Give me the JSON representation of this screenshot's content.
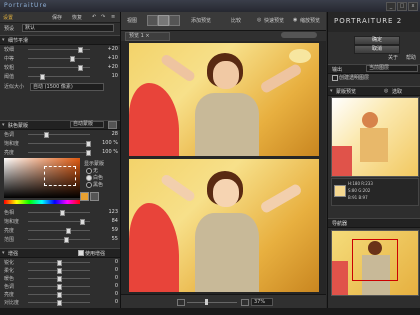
{
  "app": {
    "title": "PortraitUre"
  },
  "left": {
    "tabs": [
      "设置",
      "保存",
      "恢复"
    ],
    "preset_label": "预设",
    "preset_value": "默认",
    "sections": {
      "smooth": "细节平滑",
      "skin": "肤色蒙版",
      "enhance": "增强"
    },
    "smooth_rows": [
      {
        "label": "较细",
        "value": "+20"
      },
      {
        "label": "中等",
        "value": "+10"
      },
      {
        "label": "较粗",
        "value": "+20"
      },
      {
        "label": "阈值",
        "value": "10"
      }
    ],
    "size_label": "近似大小",
    "size_value": "自动 (1500 像素)",
    "skin_mode": "自动蒙版",
    "skin_rows": [
      {
        "label": "色调",
        "value": "28"
      },
      {
        "label": "饱和度",
        "value": "100 %"
      },
      {
        "label": "亮度",
        "value": "100 %"
      }
    ],
    "show_mask": "显示蒙版",
    "mask_opts": [
      "无",
      "白色",
      "黑色"
    ],
    "hsl_rows": [
      {
        "label": "色相",
        "value": "123"
      },
      {
        "label": "饱和度",
        "value": "84"
      },
      {
        "label": "亮度",
        "value": "59"
      },
      {
        "label": "范围",
        "value": "55"
      }
    ],
    "enhance_toggle": "使用增强",
    "enhance_rows": [
      {
        "label": "锐化",
        "value": "0"
      },
      {
        "label": "柔化",
        "value": "0"
      },
      {
        "label": "暖色",
        "value": "0"
      },
      {
        "label": "色调",
        "value": "0"
      },
      {
        "label": "亮度",
        "value": "0"
      },
      {
        "label": "对比度",
        "value": "0"
      }
    ]
  },
  "center": {
    "toolbar": {
      "view_label": "视图",
      "add_label": "添加预览",
      "compare_label": "比较",
      "fast_label": "快速预览",
      "zoom_label": "缩放预览"
    },
    "tab_label": "预览 1",
    "zoom_value": "37%"
  },
  "right": {
    "brand": "PORTRAITURE 2",
    "ok": "确定",
    "cancel": "取消",
    "about": "关于",
    "help": "帮助",
    "output_label": "输出",
    "output_value": "当前图层",
    "new_layer": "创建透明图层",
    "preview_label": "蒙版预览",
    "pick_label": "选取",
    "info_rgb": "H:180 R:233",
    "info_g": "S:80 G:202",
    "info_b": "B:91 B:97",
    "nav_label": "导航器"
  }
}
